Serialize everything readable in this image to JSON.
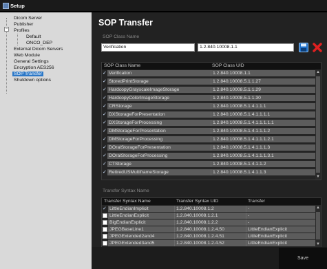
{
  "window": {
    "title": "Setup"
  },
  "tree": {
    "items": [
      {
        "label": "Dicom Server",
        "level": 0
      },
      {
        "label": "Publisher",
        "level": 0
      },
      {
        "label": "Profiles",
        "level": 0,
        "expanded": true
      },
      {
        "label": "Default",
        "level": 1
      },
      {
        "label": "ONCO_DEP",
        "level": 1
      },
      {
        "label": "External Dicom Servers",
        "level": 0
      },
      {
        "label": "Web Module",
        "level": 0
      },
      {
        "label": "General Settings",
        "level": 0
      },
      {
        "label": "Encryption AES256",
        "level": 0
      },
      {
        "label": "SOP Transfer",
        "level": 0,
        "selected": true
      },
      {
        "label": "Shutdown options",
        "level": 0
      }
    ]
  },
  "main": {
    "title": "SOP Transfer",
    "sop_class_name_label": "SOP Class Name",
    "name_field": "Verification",
    "uid_field": "1.2.840.10008.1.1",
    "sop_grid": {
      "headers": [
        "SOP Class Name",
        "SOP Class UID"
      ],
      "rows": [
        {
          "name": "Verification",
          "uid": "1.2.840.10008.1.1",
          "checked": true
        },
        {
          "name": "StoredPrintStorage",
          "uid": "1.2.840.10008.5.1.1.27",
          "checked": true
        },
        {
          "name": "HardcopyGrayscaleImageStorage",
          "uid": "1.2.840.10008.5.1.1.29",
          "checked": true
        },
        {
          "name": "HardcopyColorImageStorage",
          "uid": "1.2.840.10008.5.1.1.30",
          "checked": true
        },
        {
          "name": "CRStorage",
          "uid": "1.2.840.10008.5.1.4.1.1.1",
          "checked": true
        },
        {
          "name": "DXStorageForPresentation",
          "uid": "1.2.840.10008.5.1.4.1.1.1.1",
          "checked": true
        },
        {
          "name": "DXStorageForProcessing",
          "uid": "1.2.840.10008.5.1.4.1.1.1.1.1",
          "checked": true
        },
        {
          "name": "DMStorageForPresentation",
          "uid": "1.2.840.10008.5.1.4.1.1.1.2",
          "checked": true
        },
        {
          "name": "DMStorageForProcessing",
          "uid": "1.2.840.10008.5.1.4.1.1.1.2.1",
          "checked": true
        },
        {
          "name": "DOralStorageForPresentation",
          "uid": "1.2.840.10008.5.1.4.1.1.1.3",
          "checked": true
        },
        {
          "name": "DOralStorageForProcessing",
          "uid": "1.2.840.10008.5.1.4.1.1.1.3.1",
          "checked": true
        },
        {
          "name": "CTStorage",
          "uid": "1.2.840.10008.5.1.4.1.1.2",
          "checked": true
        },
        {
          "name": "RetiredUSMultiframeStorage",
          "uid": "1.2.840.10008.5.1.4.1.1.3",
          "checked": true
        }
      ]
    },
    "transfer_syntax_label": "Transfer Syntax Name",
    "ts_grid": {
      "headers": [
        "Transfer Syntax Name",
        "Transfer Syntax UID",
        "Transfer"
      ],
      "rows": [
        {
          "name": "LittleEndianImplicit",
          "uid": "1.2.840.10008.1.2",
          "transfer": "-",
          "checked": true
        },
        {
          "name": "LittleEndianExplicit",
          "uid": "1.2.840.10008.1.2.1",
          "transfer": "-",
          "checked": false
        },
        {
          "name": "BigEndianExplicit",
          "uid": "1.2.840.10008.1.2.2",
          "transfer": "-",
          "checked": false
        },
        {
          "name": "JPEGBaseLine1",
          "uid": "1.2.840.10008.1.2.4.50",
          "transfer": "LittleEndianExplicit",
          "checked": false
        },
        {
          "name": "JPEGExtended2and4",
          "uid": "1.2.840.10008.1.2.4.51",
          "transfer": "LittleEndianExplicit",
          "checked": false
        },
        {
          "name": "JPEGExtended3and5",
          "uid": "1.2.840.10008.1.2.4.52",
          "transfer": "LittleEndianExplicit",
          "checked": false
        }
      ]
    },
    "save_label": "Save"
  },
  "icons": {
    "save": "floppy-disk-icon",
    "delete": "red-x-icon",
    "app": "setup-app-icon"
  },
  "colors": {
    "selection": "#2c78c7",
    "save_icon": "#1f6fc6",
    "delete_icon": "#e02020"
  }
}
